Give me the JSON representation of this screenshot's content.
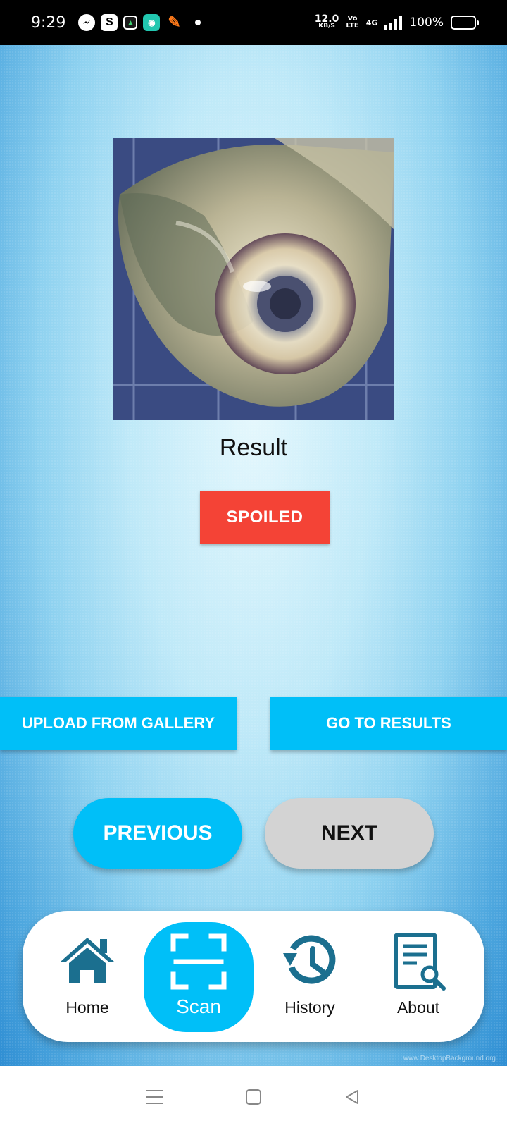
{
  "status_bar": {
    "time": "9:29",
    "speed_value": "12.0",
    "speed_unit": "KB/S",
    "volte_top": "Vo",
    "volte_bottom": "LTE",
    "network": "4G",
    "battery": "100%",
    "icons": [
      "messenger-icon",
      "s-app-icon",
      "green-app-icon",
      "teal-app-icon",
      "orange-app-icon"
    ]
  },
  "scan": {
    "result_label": "Result",
    "result_value": "SPOILED",
    "result_color": "#f44336"
  },
  "actions": {
    "upload_label": "UPLOAD FROM GALLERY",
    "results_label": "GO TO RESULTS"
  },
  "pager": {
    "previous_label": "PREVIOUS",
    "next_label": "NEXT"
  },
  "bottom_nav": {
    "items": [
      {
        "label": "Home",
        "icon": "home-icon"
      },
      {
        "label": "Scan",
        "icon": "scan-icon",
        "active": true
      },
      {
        "label": "History",
        "icon": "history-icon"
      },
      {
        "label": "About",
        "icon": "about-icon"
      }
    ]
  },
  "watermark": "www.DesktopBackground.org",
  "colors": {
    "accent": "#00bff8",
    "nav_icon": "#1b6f8f",
    "spoiled": "#f44336",
    "next_button": "#d3d3d3"
  }
}
